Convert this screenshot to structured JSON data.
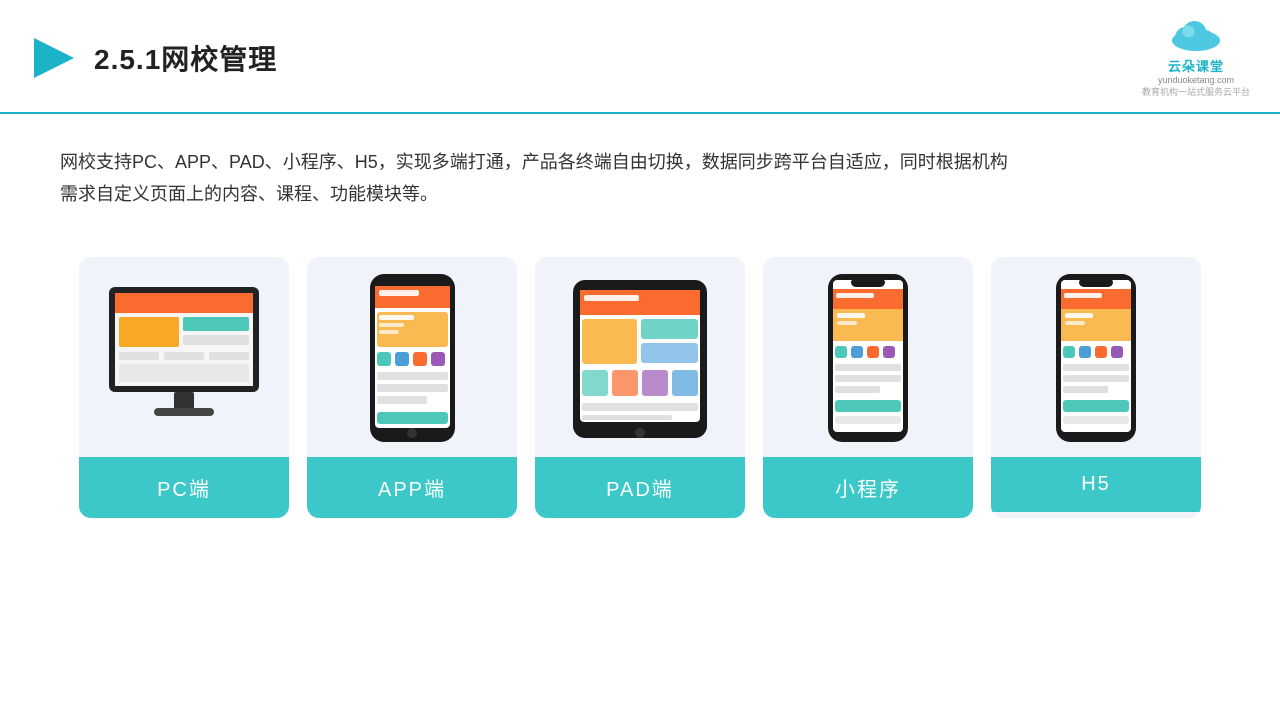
{
  "header": {
    "title": "2.5.1网校管理",
    "logo_name": "云朵课堂",
    "logo_url": "yunduoketang.com",
    "logo_tagline": "教育机构一站式服务云平台"
  },
  "description": {
    "text1": "网校支持PC、APP、PAD、小程序、H5，实现多端打通，产品各终端自由切换，数据同步跨平台自适应，同时根据机构",
    "text2": "需求自定义页面上的内容、课程、功能模块等。"
  },
  "cards": [
    {
      "id": "pc",
      "label": "PC端"
    },
    {
      "id": "app",
      "label": "APP端"
    },
    {
      "id": "pad",
      "label": "PAD端"
    },
    {
      "id": "miniapp",
      "label": "小程序"
    },
    {
      "id": "h5",
      "label": "H5"
    }
  ]
}
